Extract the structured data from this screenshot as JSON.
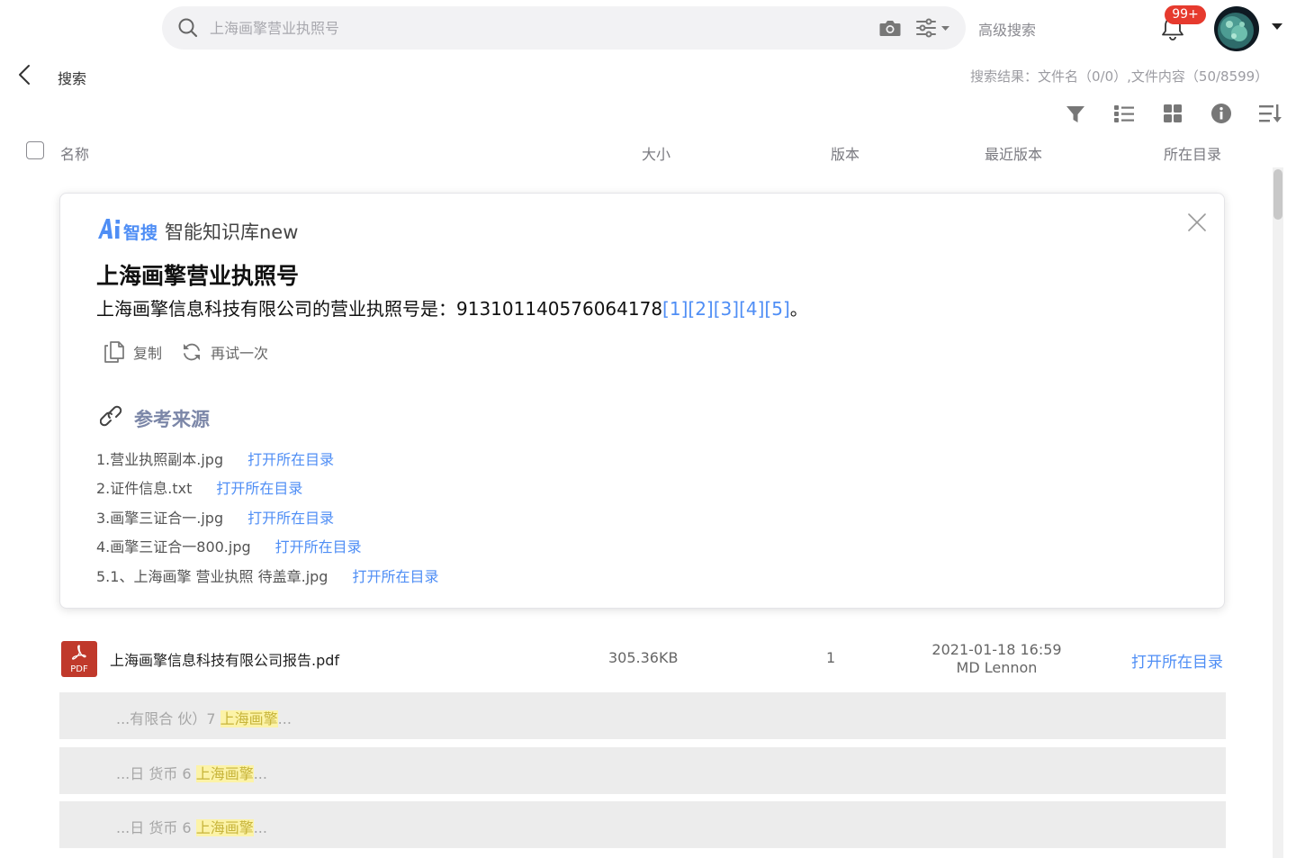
{
  "search": {
    "placeholder": "上海画擎营业执照号",
    "advanced_label": "高级搜索"
  },
  "notifications": {
    "badge": "99+"
  },
  "page": {
    "title": "搜索",
    "result_summary": "搜索结果：文件名（0/0）,文件内容（50/8599）"
  },
  "table_header": {
    "name": "名称",
    "size": "大小",
    "version": "版本",
    "latest_version": "最近版本",
    "directory": "所在目录"
  },
  "ai_card": {
    "brand": "智搜",
    "product": "智能知识库new",
    "query": "上海画擎营业执照号",
    "answer": "上海画擎信息科技有限公司的营业执照号是：913101140576064178",
    "citations": [
      "[1]",
      "[2]",
      "[3]",
      "[4]",
      "[5]"
    ],
    "answer_end": "。",
    "copy_label": "复制",
    "retry_label": "再试一次",
    "references_title": "参考来源",
    "references": [
      {
        "name": "1.营业执照副本.jpg",
        "link": "打开所在目录"
      },
      {
        "name": "2.证件信息.txt",
        "link": "打开所在目录"
      },
      {
        "name": "3.画擎三证合一.jpg",
        "link": "打开所在目录"
      },
      {
        "name": "4.画擎三证合一800.jpg",
        "link": "打开所在目录"
      },
      {
        "name": "5.1、上海画擎 营业执照 待盖章.jpg",
        "link": "打开所在目录"
      }
    ]
  },
  "file": {
    "icon_label": "PDF",
    "name": "上海画擎信息科技有限公司报告.pdf",
    "size": "305.36KB",
    "version": "1",
    "date": "2021-01-18 16:59",
    "author": "MD Lennon",
    "open_label": "打开所在目录"
  },
  "snippets": [
    {
      "before": "...有限合 伙）7 ",
      "highlight": "上海画擎",
      "after": "..."
    },
    {
      "before": "...日 货币 6 ",
      "highlight": "上海画擎",
      "after": "..."
    },
    {
      "before": "...日 货币 6 ",
      "highlight": "上海画擎",
      "after": "..."
    }
  ],
  "colors": {
    "accent": "#4f8ef5",
    "badge": "#e63a2e",
    "pdf": "#c0392b",
    "highlight": "#fcf3a8"
  },
  "icons": [
    "search-icon",
    "camera-icon",
    "sliders-icon",
    "bell-icon",
    "back-icon",
    "filter-icon",
    "list-view-icon",
    "grid-view-icon",
    "info-icon",
    "sort-icon",
    "close-icon",
    "copy-icon",
    "refresh-icon",
    "link-icon",
    "pdf-icon"
  ]
}
